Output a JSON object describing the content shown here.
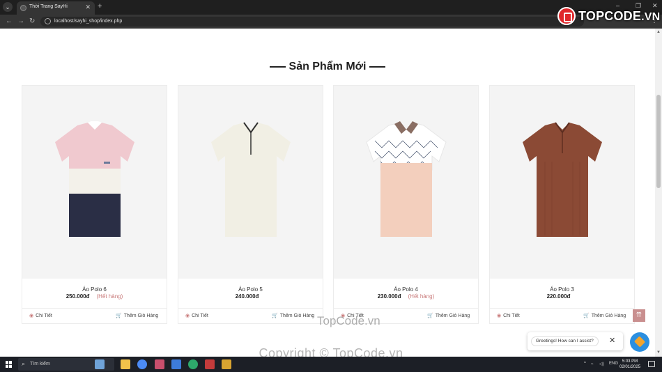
{
  "browser": {
    "tab_title": "Thời Trang SayHi",
    "url": "localhost/sayhi_shop/index.php"
  },
  "watermark": {
    "logo_text": "TOPCODE",
    "logo_tld": ".VN",
    "center_text": "TopCode.vn",
    "bottom_text": "Copyright © TopCode.vn"
  },
  "section": {
    "title": "Sản Phẩm Mới"
  },
  "products": [
    {
      "name": "Áo Polo 6",
      "price": "250.000đ",
      "stock": "(Hết hàng)",
      "detail_label": "Chi Tiết",
      "cart_label": "Thêm Giỏ Hàng"
    },
    {
      "name": "Áo Polo 5",
      "price": "240.000đ",
      "stock": "",
      "detail_label": "Chi Tiết",
      "cart_label": "Thêm Giỏ Hàng"
    },
    {
      "name": "Áo Polo 4",
      "price": "230.000đ",
      "stock": "(Hết hàng)",
      "detail_label": "Chi Tiết",
      "cart_label": "Thêm Giỏ Hàng"
    },
    {
      "name": "Áo Polo 3",
      "price": "220.000đ",
      "stock": "",
      "detail_label": "Chi Tiết",
      "cart_label": "Thêm Giỏ Hàng"
    }
  ],
  "chat": {
    "greeting": "Greetings! How can I assist?"
  },
  "taskbar": {
    "search_placeholder": "Tìm kiếm",
    "language": "ENG",
    "time": "5:03 PM",
    "date": "02/01/2025"
  },
  "colors": {
    "accent": "#c98f8f",
    "stock_text": "#c97b7b",
    "chat_button": "#2b8fe0"
  }
}
